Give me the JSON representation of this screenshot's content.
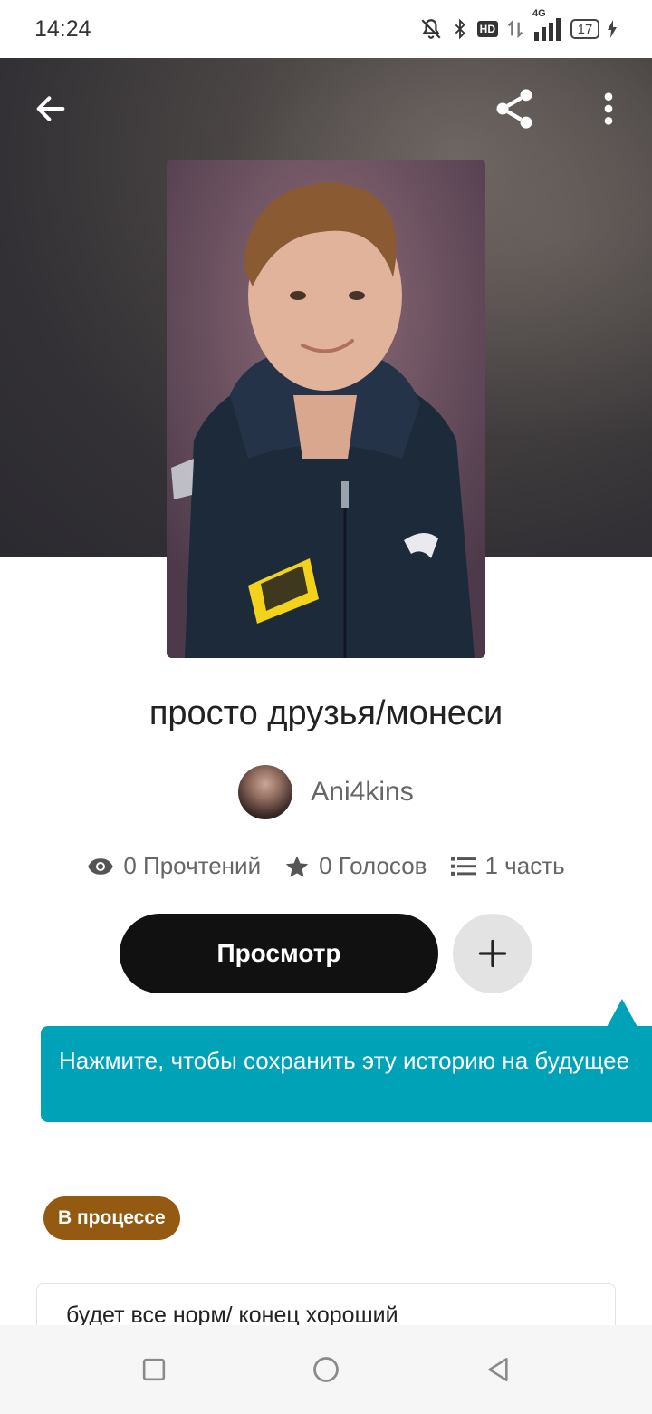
{
  "status_bar": {
    "time": "14:24",
    "hd_label": "HD",
    "network_label": "4G",
    "battery_level": "17",
    "icons": [
      "mute-bell-icon",
      "bluetooth-icon",
      "hd-icon",
      "data-arrows-icon",
      "signal-4g-icon",
      "battery-icon",
      "charging-icon"
    ]
  },
  "header": {
    "back_icon": "arrow-left-icon",
    "share_icon": "share-icon",
    "more_icon": "more-vertical-icon"
  },
  "story": {
    "title": "просто друзья/монеси",
    "author": "Ani4kins",
    "stats": {
      "reads": "0 Прочтений",
      "votes": "0 Голосов",
      "parts": "1 часть"
    },
    "read_button": "Просмотр",
    "add_icon": "plus-icon",
    "status": "В процессе",
    "description": "будет все норм/ конец хороший"
  },
  "tooltip": {
    "text": "Нажмите, чтобы сохранить эту историю на будущее"
  },
  "colors": {
    "primary_button": "#121112",
    "tooltip": "#00a2b8",
    "status_badge": "#955a12"
  },
  "nav_bar": {
    "icons": [
      "recents-square-icon",
      "home-circle-icon",
      "back-triangle-icon"
    ]
  }
}
